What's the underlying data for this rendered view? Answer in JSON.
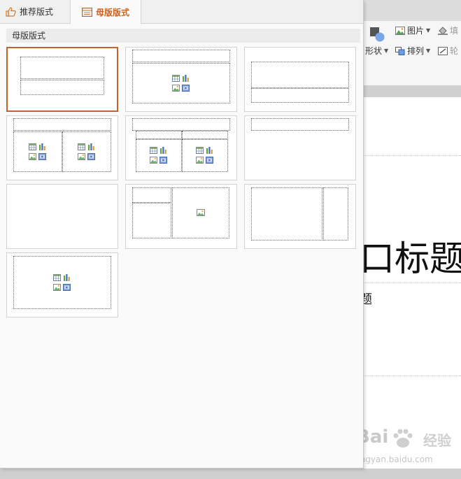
{
  "ribbon": {
    "picture_label": "图片",
    "fill_label": "填",
    "shape_label": "形状",
    "arrange_label": "排列",
    "outline_label": "轮"
  },
  "slide": {
    "title_fragment": "口标题",
    "subtitle_fragment": "题"
  },
  "layout_panel": {
    "tabs": [
      {
        "label": "推荐版式",
        "icon": "thumbs-up-icon",
        "active": false
      },
      {
        "label": "母版版式",
        "icon": "layout-grid-icon",
        "active": true
      }
    ],
    "section_title": "母版版式",
    "selected_index": 0
  },
  "watermark": {
    "brand": "Bai",
    "brand_suffix": "经验",
    "url": "jingyan.baidu.com"
  },
  "colors": {
    "accent": "#c9631f",
    "selection_border": "#c2642b"
  }
}
